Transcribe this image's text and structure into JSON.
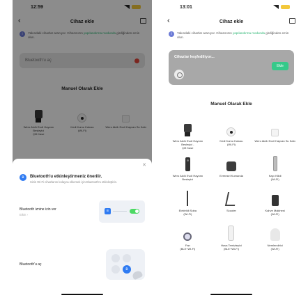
{
  "left": {
    "status": {
      "time": "12:59"
    },
    "header": {
      "title": "Cihaz ekle"
    },
    "notice": {
      "text": "Yakındaki cihazlar aranıyor. Cihazınızın",
      "link": "yapılandırma modunda",
      "text2": "girdiğinden emin olun."
    },
    "bt_bar": {
      "label": "Bluetooth'u aç"
    },
    "section": {
      "title": "Manuel Olarak Ekle"
    },
    "devices": [
      {
        "name": "Wero Akıllı Evcil Hayvan Besleyici",
        "sub": "Çift Kase",
        "icon": "pet-feeder-icon"
      },
      {
        "name": "Kedi Kumu Kutusu",
        "sub": "(Wi-Fi)",
        "icon": "litter-box-icon"
      },
      {
        "name": "Wero Akıllı Evcil Hayvan Su Kabı",
        "sub": "",
        "icon": "water-fountain-icon"
      }
    ],
    "sheet": {
      "title": "Bluetooth'u etkinleştirmeniz önerilir.",
      "desc": "Sizin Wi-Fi cihazlarını kolayca eklemek için Bluetooth'u etkinleştirin.",
      "row1_label": "Bluetooth iznine izin ver",
      "row1_sub": "Etkin ›",
      "row2_label": "Bluetooth'u aç",
      "bt_glyph": "ʙ"
    }
  },
  "right": {
    "status": {
      "time": "13:01"
    },
    "header": {
      "title": "Cihaz ekle"
    },
    "notice": {
      "text": "Yakındaki cihazlar aranıyor. Cihazınızın",
      "link": "yapılandırma modunda",
      "text2": "girdiğinden emin olun."
    },
    "discover": {
      "title": "Cihazlar keşfediliyor...",
      "add_label": "Ekle"
    },
    "section": {
      "title": "Manuel Olarak Ekle"
    },
    "devices": [
      {
        "name": "Wero Akıllı Evcil Hayvan Besleyici -",
        "sub": "Çift Kase",
        "icon": "pet-feeder-icon"
      },
      {
        "name": "Kedi Kumu Kutusu",
        "sub": "(Wi-Fi)",
        "icon": "litter-box-icon"
      },
      {
        "name": "Wero Akıllı Evcil Hayvan Su Kabı",
        "sub": "",
        "icon": "water-fountain-icon"
      },
      {
        "name": "Wero Akıllı Evcil Hayvan Besleyici",
        "sub": "",
        "icon": "smart-doorbell-icon"
      },
      {
        "name": "Evrensel Kumanda",
        "sub": "",
        "icon": "universal-remote-icon"
      },
      {
        "name": "Kapı Kilidi",
        "sub": "(Wi-Fi)",
        "icon": "door-lock-icon"
      },
      {
        "name": "Elektrikli Sobа",
        "sub": "(Wi-Fi)",
        "icon": "electric-heater-icon"
      },
      {
        "name": "Scooter",
        "sub": "",
        "icon": "scooter-icon"
      },
      {
        "name": "Kahve Makinesi",
        "sub": "(Wi-Fi)",
        "icon": "coffee-machine-icon"
      },
      {
        "name": "Fan",
        "sub": "(BLE+Wi-Fi)",
        "icon": "fan-icon"
      },
      {
        "name": "Hava Temizleyici",
        "sub": "(BLE+Wi-Fi)",
        "icon": "air-purifier-icon"
      },
      {
        "name": "Nemlendirici",
        "sub": "(Wi-Fi)",
        "icon": "humidifier-icon"
      }
    ]
  },
  "colors": {
    "accent_green": "#36c98a",
    "bluetooth_blue": "#2f7bf2",
    "bt_off_red": "#e0463b",
    "battery": "#f3c83b"
  }
}
